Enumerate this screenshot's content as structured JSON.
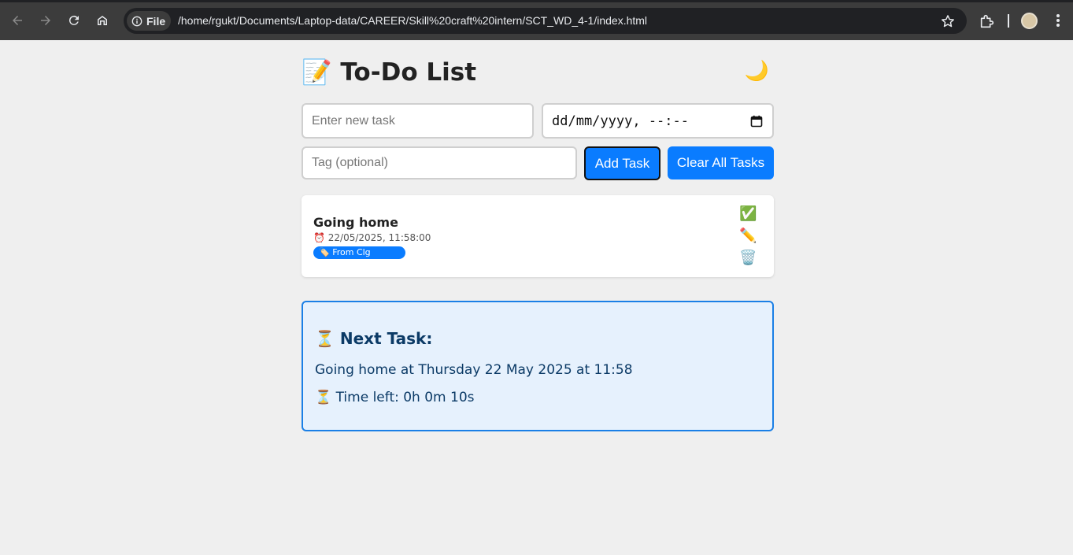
{
  "browser": {
    "site_chip": "File",
    "url": "/home/rgukt/Documents/Laptop-data/CAREER/Skill%20craft%20intern/SCT_WD_4-1/index.html"
  },
  "app": {
    "title_emoji": "📝",
    "title": "To-Do List",
    "theme_toggle": "🌙"
  },
  "form": {
    "task_placeholder": "Enter new task",
    "date_placeholder": "dd/mm/yyyy, --:--",
    "tag_placeholder": "Tag (optional)",
    "add_label": "Add Task",
    "clear_label": "Clear All Tasks"
  },
  "tasks": [
    {
      "name": "Going home",
      "time": "⏰ 22/05/2025, 11:58:00",
      "tag": "🏷️ From Clg",
      "actions": {
        "complete": "✅",
        "edit": "✏️",
        "delete": "🗑️"
      }
    }
  ],
  "next_task": {
    "heading": "⏳ Next Task:",
    "line": "Going home at Thursday 22 May 2025 at 11:58",
    "time_left": "⏳ Time left: 0h 0m 10s"
  },
  "colors": {
    "accent": "#0a7cff",
    "next_box_bg": "#e6f1fd",
    "next_box_border": "#1a7fe6",
    "page_bg": "#efefef"
  }
}
